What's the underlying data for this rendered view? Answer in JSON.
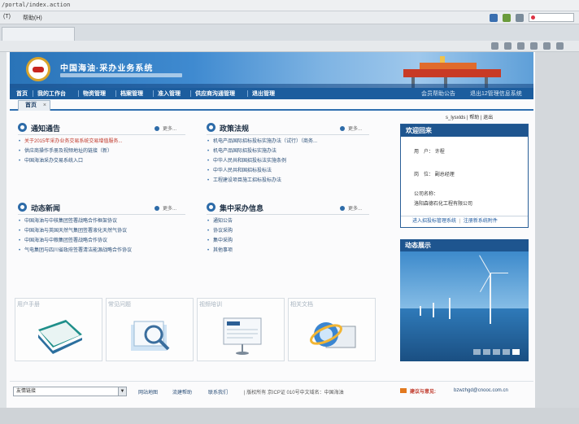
{
  "browser": {
    "url": "/portal/index.action",
    "menu": [
      "(T)",
      "帮助(H)"
    ]
  },
  "banner": {
    "title": "中国海油·采办业务系统"
  },
  "nav": {
    "items": [
      "首页",
      "我的工作台",
      "物资管理",
      "档案管理",
      "准入管理",
      "供应商沟通管理",
      "退出管理"
    ],
    "right_links": [
      "会员帮助公告",
      "退出12管理信息系统"
    ]
  },
  "tab": {
    "label": "首页",
    "close": "×"
  },
  "user_bar": "s_lysxlds | 帮助 | 退出",
  "panels": {
    "notice": {
      "title": "通知通告",
      "more": "更多...",
      "items": [
        "关于2015年采办业务交易系统交易增值服务...",
        "供应商操作手册及视频地址的链接（新）",
        "中国海油采办交易系统入口"
      ]
    },
    "policy": {
      "title": "政策法规",
      "more": "更多...",
      "items": [
        "机电产品国际招标投标实施办法（试行）（商务...",
        "机电产品国际招投标实施办法",
        "中华人民共和国招投标法实施条例",
        "中华人民共和国招标投标法",
        "工程建设项目施工招标投标办法"
      ]
    },
    "news": {
      "title": "动态新闻",
      "more": "更多...",
      "items": [
        "中国海油与中核集团签署战略合作框架协议",
        "中国海油与英国天然气集团签署液化天然气协议",
        "中国海油与中粮集团签署战略合作协议",
        "气电集团与四川省政府签署清洁能源战略合作协议"
      ]
    },
    "centralized": {
      "title": "集中采办信息",
      "more": "更多...",
      "items": [
        "通知公告",
        "协议采购",
        "集中采购",
        "其他事项"
      ]
    }
  },
  "welcome": {
    "title": "欢迎回来",
    "user_label": "用　户：",
    "user_value": "许程",
    "post_label": "岗　位：",
    "post_value": "副总经理",
    "company_label": "公司名称：",
    "company_value": "洛阳森德石化工程有限公司",
    "link1": "进入招投标管理系统",
    "link2": "注册新系统附件"
  },
  "showcase": {
    "title": "动态展示"
  },
  "tiles": [
    "用户手册",
    "常见问题",
    "视频培训",
    "相关文档"
  ],
  "footer": {
    "select_label": "友情链接",
    "links": [
      "网站地图",
      "流建帮助",
      "联系我们"
    ],
    "copyright": "| 版权所有 京ICP证 010号中文域名：中国海油",
    "suggest_label": "建议与意见:",
    "email": "bzwzhgd@cnooc.com.cn"
  }
}
